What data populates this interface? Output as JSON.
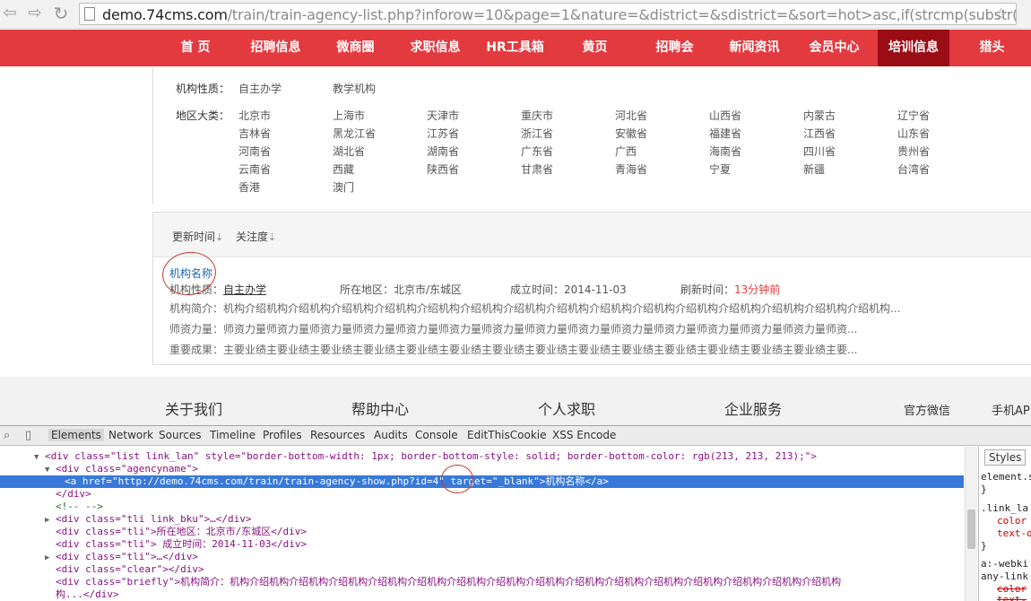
{
  "browser": {
    "url_host": "demo.74cms.com",
    "url_rest": "/train/train-agency-list.php?inforow=10&page=1&nature=&district=&sdistrict=&sort=hot>asc,if(strcmp(substr("
  },
  "nav": {
    "items": [
      "首 页",
      "招聘信息",
      "微商圈",
      "求职信息",
      "HR工具箱",
      "黄页",
      "招聘会",
      "新闻资讯",
      "会员中心",
      "培训信息",
      "猎头"
    ],
    "active": "培训信息"
  },
  "filter": {
    "nature_label": "机构性质：",
    "nature_options": [
      "自主办学",
      "教学机构"
    ],
    "district_label": "地区大类：",
    "district_rows": [
      [
        "北京市",
        "上海市",
        "天津市",
        "重庆市",
        "河北省",
        "山西省",
        "内蒙古",
        "辽宁省"
      ],
      [
        "吉林省",
        "黑龙江省",
        "江苏省",
        "浙江省",
        "安徽省",
        "福建省",
        "江西省",
        "山东省"
      ],
      [
        "河南省",
        "湖北省",
        "湖南省",
        "广东省",
        "广西",
        "海南省",
        "四川省",
        "贵州省"
      ],
      [
        "云南省",
        "西藏",
        "陕西省",
        "甘肃省",
        "青海省",
        "宁夏",
        "新疆",
        "台湾省"
      ],
      [
        "香港",
        "澳门"
      ]
    ]
  },
  "list": {
    "sort_update": "更新时间",
    "sort_attention": "关注度",
    "sort_arrow": "⇣",
    "agency_name": "机构名称",
    "nature_label": "机构性质：",
    "nature_value": "自主办学",
    "district": "所在地区：北京市/东城区",
    "founded": "成立时间：2014-11-03",
    "refresh_label": "刷新时间：",
    "refresh_value": "13分钟前",
    "brief": "机构简介：机构介绍机构介绍机构介绍机构介绍机构介绍机构介绍机构介绍机构介绍机构介绍机构介绍机构介绍机构介绍机构介绍机构介绍机构介绍机构...",
    "teachers": "师资力量：师资力量师资力量师资力量师资力量师资力量师资力量师资力量师资力量师资力量师资力量师资力量师资力量师资力量师资力量师资...",
    "achievements": "重要成果：主要业绩主要业绩主要业绩主要业绩主要业绩主要业绩主要业绩主要业绩主要业绩主要业绩主要业绩主要业绩主要业绩主要业绩主要..."
  },
  "footer": {
    "about": "关于我们",
    "help": "帮助中心",
    "personal": "个人求职",
    "enterprise": "企业服务",
    "wechat": "官方微信",
    "mobile": "手机AP"
  },
  "devtools": {
    "tabs": [
      "Elements",
      "Network",
      "Sources",
      "Timeline",
      "Profiles",
      "Resources",
      "Audits",
      "Console",
      "EditThisCookie",
      "XSS Encode"
    ],
    "active_tab": "Elements",
    "lines": [
      "<div class=\"list link_lan\" style=\"border-bottom-width: 1px; border-bottom-style: solid; border-bottom-color: rgb(213, 213, 213);\">",
      "<div class=\"agencyname\">",
      "<a href=\"http://demo.74cms.com/train/train-agency-show.php?id=4\" target=\"_blank\">机构名称</a>",
      "</div>",
      "<!-- -->",
      "<div class=\"tli link_bku\">…</div>",
      "<div class=\"tli\">所在地区：北京市/东城区</div>",
      "<div class=\"tli\"> 成立时间：2014-11-03</div>",
      "<div class=\"tli\">…</div>",
      "<div class=\"clear\"></div>",
      "<div class=\"briefly\">机构简介：机构介绍机构介绍机构介绍机构介绍机构介绍机构介绍机构介绍机构介绍机构介绍机构介绍机构介绍机构介绍机构介绍机构介绍机构介绍机构",
      "构...</div>"
    ],
    "styles_tab": "Styles",
    "styles_lines": [
      "element.s",
      "}",
      ".link_la",
      "color",
      "text-d",
      "}",
      "a:-webki",
      "any-link",
      "color",
      "text-"
    ]
  }
}
